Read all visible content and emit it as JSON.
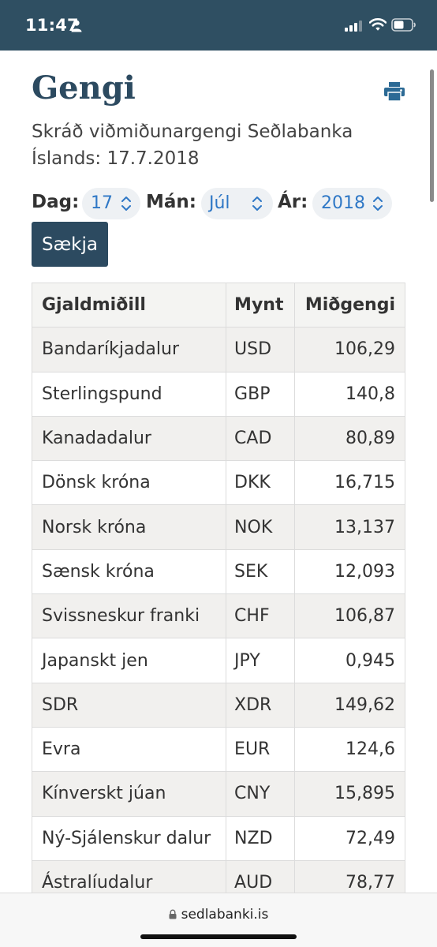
{
  "status": {
    "time": "11:47"
  },
  "header": {
    "title": "Gengi",
    "subtitle": "Skráð viðmiðunargengi Seðlabanka Íslands: 17.7.2018"
  },
  "filters": {
    "day_label": "Dag:",
    "day_value": "17",
    "month_label": "Mán:",
    "month_value": "Júl",
    "year_label": "Ár:",
    "year_value": "2018",
    "fetch_label": "Sækja"
  },
  "table": {
    "headers": [
      "Gjaldmiðill",
      "Mynt",
      "Miðgengi"
    ],
    "rows": [
      [
        "Bandaríkjadalur",
        "USD",
        "106,29"
      ],
      [
        "Sterlingspund",
        "GBP",
        "140,8"
      ],
      [
        "Kanadadalur",
        "CAD",
        "80,89"
      ],
      [
        "Dönsk króna",
        "DKK",
        "16,715"
      ],
      [
        "Norsk króna",
        "NOK",
        "13,137"
      ],
      [
        "Sænsk króna",
        "SEK",
        "12,093"
      ],
      [
        "Svissneskur franki",
        "CHF",
        "106,87"
      ],
      [
        "Japanskt jen",
        "JPY",
        "0,945"
      ],
      [
        "SDR",
        "XDR",
        "149,62"
      ],
      [
        "Evra",
        "EUR",
        "124,6"
      ],
      [
        "Kínverskt júan",
        "CNY",
        "15,895"
      ],
      [
        "Ný-Sjálenskur dalur",
        "NZD",
        "72,49"
      ],
      [
        "Ástralíudalur",
        "AUD",
        "78,77"
      ]
    ]
  },
  "browser": {
    "url": "sedlabanki.is"
  },
  "colors": {
    "brand": "#2c4a60",
    "statusbar": "#2f4f62",
    "link": "#2f78c6"
  }
}
